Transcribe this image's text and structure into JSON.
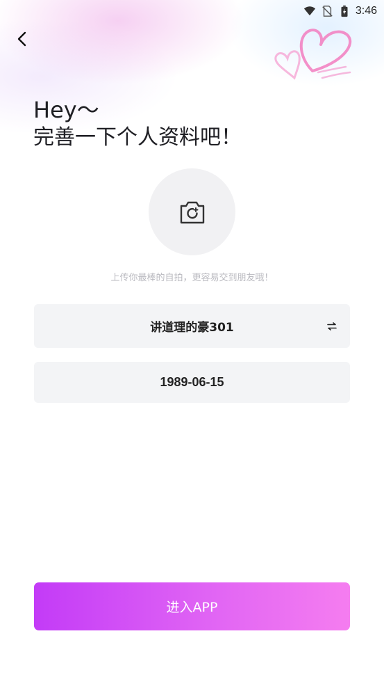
{
  "status_bar": {
    "time": "3:46",
    "icons": [
      "wifi-icon",
      "no-sim-icon",
      "battery-charging-icon"
    ]
  },
  "header": {
    "back_icon": "chevron-left-icon",
    "decoration": "hearts-illustration"
  },
  "title": {
    "line1": "Hey～",
    "line2": "完善一下个人资料吧！"
  },
  "avatar": {
    "icon": "camera-icon",
    "hint": "上传你最棒的自拍，更容易交到朋友哦！"
  },
  "form": {
    "nickname": "讲道理的豪301",
    "nickname_action_icon": "swap-icon",
    "birthday": "1989-06-15"
  },
  "actions": {
    "enter_label": "进入APP"
  },
  "colors": {
    "button_gradient_start": "#c33bf7",
    "button_gradient_end": "#f57df0",
    "field_bg": "#f3f4f6",
    "hint_text": "#b9b9bf",
    "hearts": "#f27cc0"
  }
}
